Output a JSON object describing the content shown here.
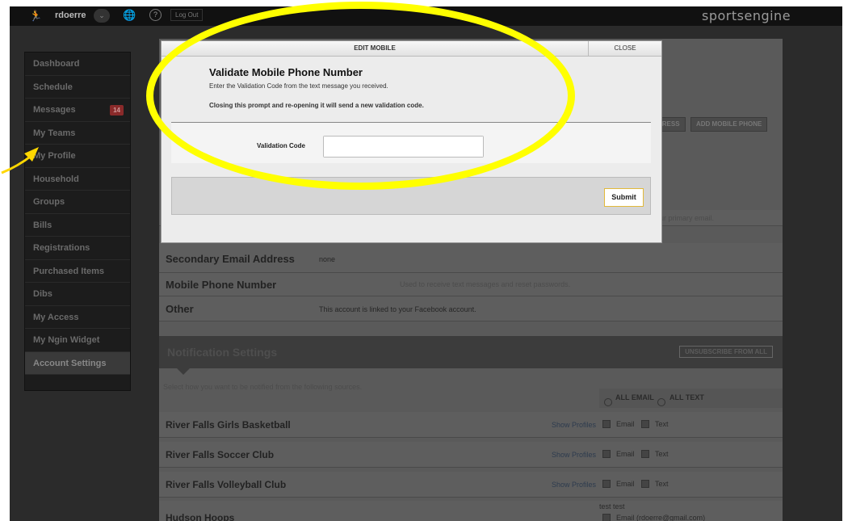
{
  "topbar": {
    "username": "rdoerre",
    "logout_label": "Log Out",
    "logo": "sportsengine"
  },
  "sidebar": {
    "items": [
      {
        "label": "Dashboard"
      },
      {
        "label": "Schedule"
      },
      {
        "label": "Messages",
        "badge": "14"
      },
      {
        "label": "My Teams"
      },
      {
        "label": "My Profile"
      },
      {
        "label": "Household"
      },
      {
        "label": "Groups"
      },
      {
        "label": "Bills"
      },
      {
        "label": "Registrations"
      },
      {
        "label": "Purchased Items"
      },
      {
        "label": "Dibs"
      },
      {
        "label": "My Access"
      },
      {
        "label": "My Ngin Widget"
      },
      {
        "label": "Account Settings",
        "active": true
      }
    ]
  },
  "main": {
    "add_email_button_fragment": "DRESS",
    "add_mobile_button": "ADD MOBILE PHONE",
    "primary_email_hint_fragment": "our primary email.",
    "rows": {
      "secondary_email": {
        "label": "Secondary Email Address",
        "value": "none"
      },
      "mobile": {
        "label": "Mobile Phone Number",
        "hint": "Used to receive text messages and reset passwords."
      },
      "other": {
        "label": "Other",
        "value": "This account is linked to your Facebook account."
      }
    },
    "notifications": {
      "title": "Notification Settings",
      "unsubscribe_label": "UNSUBSCRIBE FROM ALL",
      "intro": "Select how you want to be notified from the following sources.",
      "all_email_label": "ALL EMAIL",
      "all_text_label": "ALL TEXT",
      "show_profiles_label": "Show Profiles",
      "email_label": "Email",
      "text_label": "Text",
      "sources": [
        {
          "name": "River Falls Girls Basketball"
        },
        {
          "name": "River Falls Soccer Club"
        },
        {
          "name": "River Falls Volleyball Club"
        },
        {
          "name": "Hudson Hoops",
          "extra_line1": "test test",
          "extra_line2": "Email (rdoerre@gmail.com)"
        }
      ]
    }
  },
  "modal": {
    "title": "EDIT MOBILE",
    "close_label": "CLOSE",
    "heading": "Validate Mobile Phone Number",
    "subtext": "Enter the Validation Code from the text message you received.",
    "note": "Closing this prompt and re-opening it will send a new validation code.",
    "field_label": "Validation Code",
    "field_value": "",
    "submit_label": "Submit"
  },
  "annotation": {
    "highlight_color": "#ffff00",
    "arrow_color": "#ffd700"
  }
}
